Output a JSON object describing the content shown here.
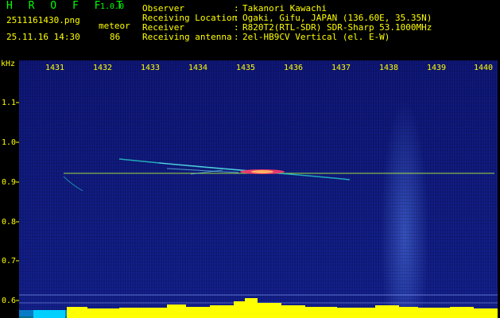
{
  "header": {
    "app_title": "H R O F F T",
    "app_version": "1.0.0",
    "filename": "2511161430.png",
    "mode_label": "meteor",
    "timestamp": "25.11.16 14:30",
    "count": "86",
    "info": [
      {
        "label": "Observer",
        "value": "Takanori Kawachi"
      },
      {
        "label": "Receiving Location",
        "value": "Ogaki, Gifu, JAPAN (136.60E, 35.35N)"
      },
      {
        "label": "Receiver",
        "value": "R820T2(RTL-SDR) SDR-Sharp 53.1000MHz"
      },
      {
        "label": "Receiving antenna",
        "value": "2el-HB9CV Vertical (el. E-W)"
      }
    ],
    "separator": ":"
  },
  "spectrogram": {
    "unit": "kHz",
    "x_ticks": [
      "1431",
      "1432",
      "1433",
      "1434",
      "1435",
      "1436",
      "1437",
      "1438",
      "1439",
      "1440"
    ],
    "y_ticks": [
      "1.1",
      "1.0",
      "0.9",
      "0.8",
      "0.7",
      "0.6"
    ],
    "colors": {
      "background": "#0d187a",
      "text": "#ffff00",
      "title": "#00ff00",
      "carrier": "#b8ff3a",
      "meteor": "#ff3a6a",
      "bars": "#ffff00"
    }
  }
}
